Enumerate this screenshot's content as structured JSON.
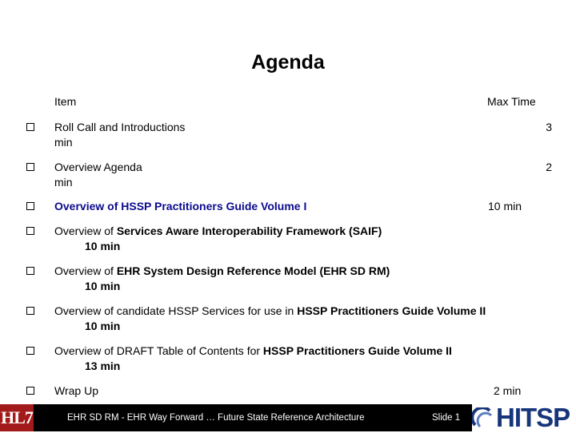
{
  "title": "Agenda",
  "header": {
    "item": "Item",
    "max_time": "Max Time"
  },
  "items": [
    {
      "parts": [
        {
          "t": "Roll Call and Introductions",
          "s": ""
        }
      ],
      "time": "3",
      "time_pos": "far",
      "second": "min",
      "second_pos": "a"
    },
    {
      "parts": [
        {
          "t": "Overview Agenda",
          "s": ""
        }
      ],
      "time": "2",
      "time_pos": "far",
      "second": "min",
      "second_pos": "a"
    },
    {
      "parts": [
        {
          "t": "Overview of HSSP Practitioners Guide Volume I",
          "s": "hl"
        }
      ],
      "time": "10 min",
      "time_pos": "mid",
      "second": "",
      "second_pos": "a"
    },
    {
      "parts": [
        {
          "t": "Overview of ",
          "s": ""
        },
        {
          "t": "Services Aware Interoperability Framework (SAIF)",
          "s": "b"
        }
      ],
      "time": "",
      "time_pos": "far",
      "second": "10 min",
      "second_pos": "b"
    },
    {
      "parts": [
        {
          "t": "Overview of ",
          "s": ""
        },
        {
          "t": "EHR System Design Reference Model (EHR SD RM)",
          "s": "b"
        }
      ],
      "time": "",
      "time_pos": "far",
      "second": "10 min",
      "second_pos": "b"
    },
    {
      "parts": [
        {
          "t": "Overview of candidate HSSP Services for use in ",
          "s": ""
        },
        {
          "t": "HSSP Practitioners Guide Volume II",
          "s": "b"
        }
      ],
      "time": "",
      "time_pos": "far",
      "second": "10 min",
      "second_pos": "b"
    },
    {
      "parts": [
        {
          "t": "Overview of DRAFT Table of Contents for ",
          "s": ""
        },
        {
          "t": "HSSP Practitioners Guide Volume II",
          "s": "b"
        }
      ],
      "time": "",
      "time_pos": "far",
      "second": "13 min",
      "second_pos": "b"
    },
    {
      "parts": [
        {
          "t": "Wrap Up",
          "s": ""
        }
      ],
      "time": "2 min",
      "time_pos": "wrap",
      "second": "",
      "second_pos": "a"
    }
  ],
  "footer": {
    "text": "EHR SD RM - EHR Way Forward … Future  State Reference Architecture",
    "slide": "Slide 1",
    "left_logo": "HL7",
    "right_logo": "HITSP"
  },
  "colors": {
    "highlight": "#0b0b8e",
    "hl7_red": "#a31a1a",
    "hitsp_blue": "#17357a"
  }
}
